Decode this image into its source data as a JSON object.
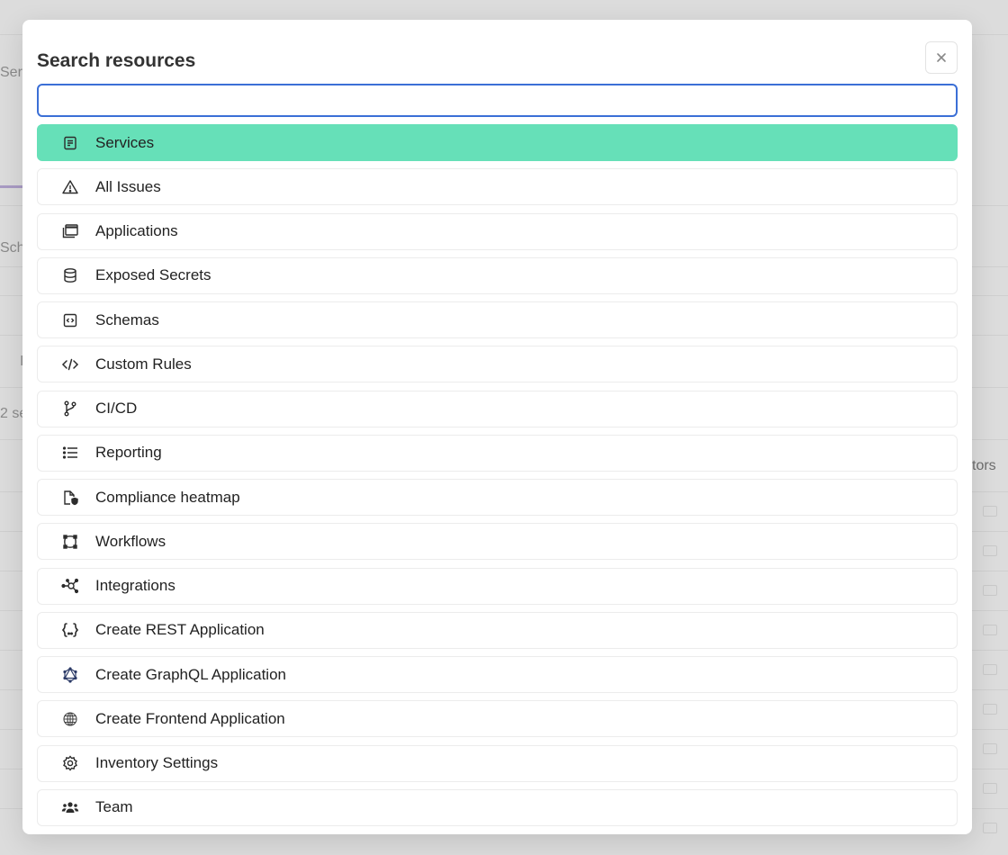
{
  "background": {
    "fragments": [
      "Serv",
      "Sch",
      "I",
      "2 se",
      "tors"
    ]
  },
  "modal": {
    "title": "Search resources",
    "search": {
      "value": "",
      "placeholder": ""
    },
    "close_icon": "close-icon",
    "items": [
      {
        "label": "Services",
        "icon": "document-icon",
        "active": true
      },
      {
        "label": "All Issues",
        "icon": "warning-triangle-icon"
      },
      {
        "label": "Applications",
        "icon": "stacked-windows-icon"
      },
      {
        "label": "Exposed Secrets",
        "icon": "database-icon"
      },
      {
        "label": "Schemas",
        "icon": "code-box-icon"
      },
      {
        "label": "Custom Rules",
        "icon": "code-brackets-icon"
      },
      {
        "label": "CI/CD",
        "icon": "git-branch-icon"
      },
      {
        "label": "Reporting",
        "icon": "list-icon"
      },
      {
        "label": "Compliance heatmap",
        "icon": "file-shield-icon"
      },
      {
        "label": "Workflows",
        "icon": "workflow-icon"
      },
      {
        "label": "Integrations",
        "icon": "network-hub-icon"
      },
      {
        "label": "Create REST Application",
        "icon": "curly-braces-icon"
      },
      {
        "label": "Create GraphQL Application",
        "icon": "graphql-icon"
      },
      {
        "label": "Create Frontend Application",
        "icon": "globe-icon"
      },
      {
        "label": "Inventory Settings",
        "icon": "gear-icon"
      },
      {
        "label": "Team",
        "icon": "team-icon"
      }
    ],
    "colors": {
      "active_item": "#66e0b8",
      "focus_border": "#3b6fd6"
    }
  }
}
